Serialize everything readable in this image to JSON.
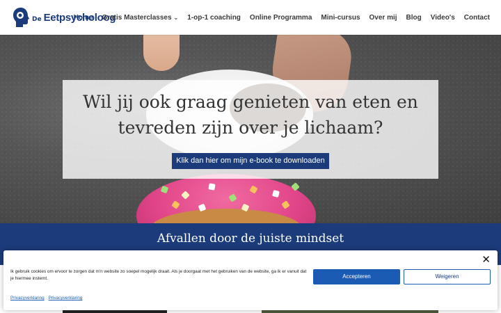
{
  "header": {
    "logo": {
      "prefix": "De",
      "name": "Eetpsycholoog",
      "icon": "head-silhouette-icon"
    },
    "nav": [
      {
        "label": "Home",
        "active": true
      },
      {
        "label": "Gratis Masterclasses",
        "has_dropdown": true
      },
      {
        "label": "1-op-1 coaching"
      },
      {
        "label": "Online Programma"
      },
      {
        "label": "Mini-cursus"
      },
      {
        "label": "Over mij"
      },
      {
        "label": "Blog"
      },
      {
        "label": "Video's"
      },
      {
        "label": "Contact"
      }
    ]
  },
  "hero": {
    "title_line1": "Wil jij ook graag genieten van eten en",
    "title_line2": "tevreden zijn over je lichaam?",
    "button_label": "Klik dan hier om mijn e-book te downloaden"
  },
  "band": {
    "title": "Afvallen door de juiste mindset"
  },
  "cookie": {
    "text": "Ik gebruik cookies om ervoor te zorgen dat m'n website zo soepel mogelijk draait. Als je doorgaat met het gebruiken van de website, ga ik er vanuit dat je hiermee instemt.",
    "accept_label": "Accepteren",
    "deny_label": "Weigeren",
    "links": [
      "Privacyverklaring",
      "Privacyverklaring"
    ],
    "close_label": "✕"
  },
  "colors": {
    "brand_blue": "#1c3b7a",
    "accept_blue": "#1c5bb3"
  }
}
